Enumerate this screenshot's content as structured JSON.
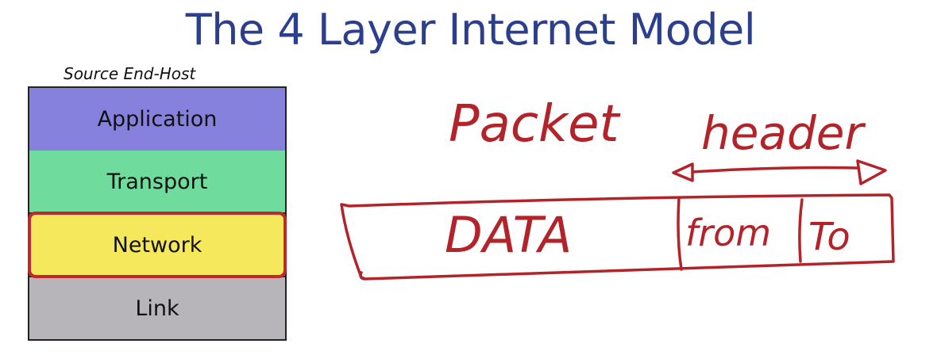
{
  "title": "The 4 Layer Internet Model",
  "stack": {
    "caption": "Source End-Host",
    "layers": [
      {
        "label": "Application",
        "color": "#8581dd"
      },
      {
        "label": "Transport",
        "color": "#6fdc9e"
      },
      {
        "label": "Network",
        "color": "#f5e85d",
        "highlighted": true
      },
      {
        "label": "Link",
        "color": "#b7b5b9"
      }
    ],
    "highlight_color": "#c1272d"
  },
  "annotation": {
    "ink_color": "#b3232a",
    "packet_label": "Packet",
    "header_label": "header",
    "fields": {
      "data": "DATA",
      "from": "from",
      "to": "To"
    }
  }
}
